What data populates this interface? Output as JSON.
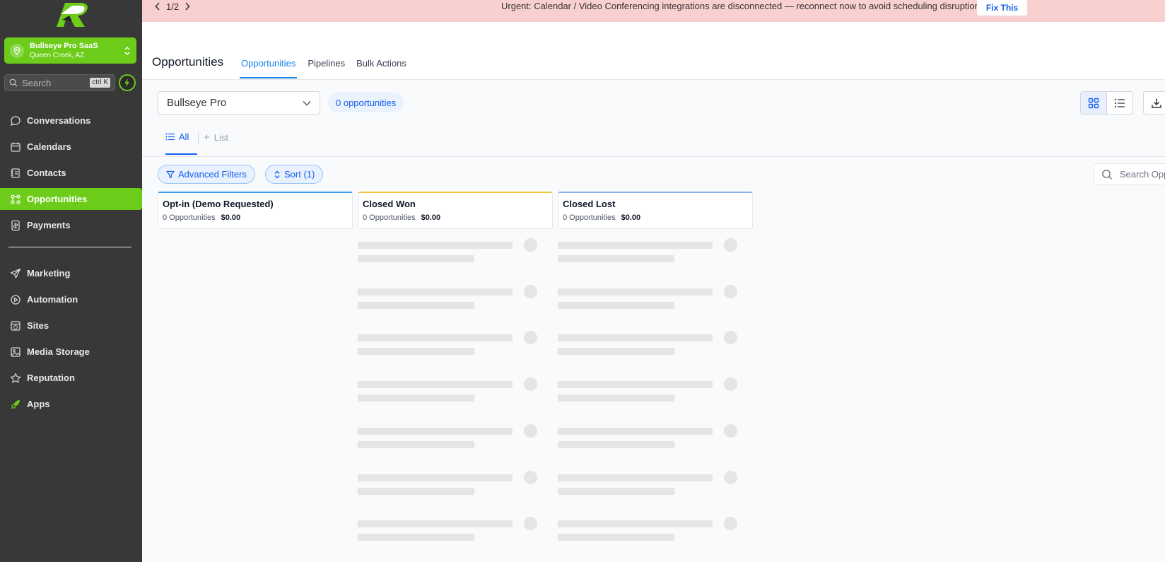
{
  "colors": {
    "sidebar_bg": "#383838",
    "brand_green": "#6dcc1a",
    "link_blue": "#155eef",
    "banner_bg": "#f9d0d0"
  },
  "sidebar": {
    "account": {
      "name": "Bullseye Pro SaaS",
      "location": "Queen Creek, AZ"
    },
    "search": {
      "placeholder": "Search",
      "shortcut": "ctrl K"
    },
    "nav_primary": [
      {
        "label": "Conversations",
        "icon": "chat-bubble-icon",
        "active": false
      },
      {
        "label": "Calendars",
        "icon": "calendar-icon",
        "active": false
      },
      {
        "label": "Contacts",
        "icon": "contact-book-icon",
        "active": false
      },
      {
        "label": "Opportunities",
        "icon": "funnel-grid-icon",
        "active": true
      },
      {
        "label": "Payments",
        "icon": "payments-icon",
        "active": false
      }
    ],
    "nav_secondary": [
      {
        "label": "Marketing",
        "icon": "paper-plane-icon"
      },
      {
        "label": "Automation",
        "icon": "automation-icon"
      },
      {
        "label": "Sites",
        "icon": "globe-window-icon"
      },
      {
        "label": "Media Storage",
        "icon": "image-icon"
      },
      {
        "label": "Reputation",
        "icon": "star-icon"
      },
      {
        "label": "Apps",
        "icon": "rocket-icon"
      }
    ]
  },
  "banner": {
    "pager": "1/2",
    "message": "Urgent: Calendar / Video Conferencing integrations are disconnected — reconnect now to avoid scheduling disruptions",
    "action": "Fix This"
  },
  "header": {
    "title": "Opportunities",
    "tabs": [
      {
        "label": "Opportunities",
        "active": true
      },
      {
        "label": "Pipelines",
        "active": false
      },
      {
        "label": "Bulk Actions",
        "active": false
      }
    ]
  },
  "toolbar": {
    "pipeline": "Bullseye Pro",
    "count_badge": "0 opportunities",
    "view_mode": "board"
  },
  "smart_lists": {
    "all": "All",
    "add_list": "List"
  },
  "filters": {
    "advanced": "Advanced Filters",
    "sort": "Sort (1)",
    "search_placeholder": "Search Opportunities"
  },
  "stages": [
    {
      "name": "Opt-in (Demo Requested)",
      "count": "0 Opportunities",
      "value": "$0.00",
      "accent": "#3b9ff0",
      "loading": false
    },
    {
      "name": "Closed Won",
      "count": "0 Opportunities",
      "value": "$0.00",
      "accent": "#f5c542",
      "loading": true
    },
    {
      "name": "Closed Lost",
      "count": "0 Opportunities",
      "value": "$0.00",
      "accent": "#8fb3e8",
      "loading": true
    }
  ]
}
